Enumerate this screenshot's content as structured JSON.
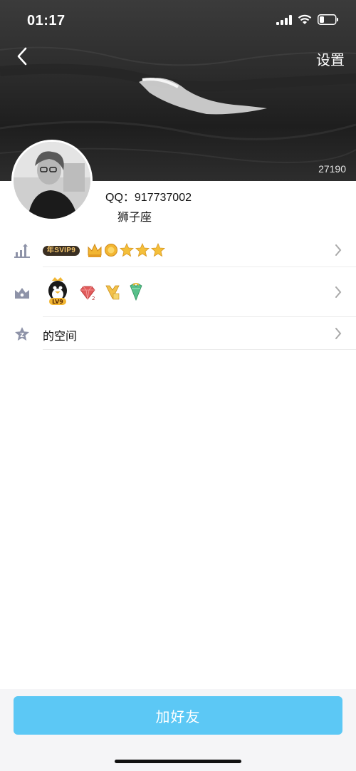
{
  "status_bar": {
    "time": "01:17",
    "icons": [
      "signal-icon",
      "wifi-icon",
      "battery-icon"
    ]
  },
  "header": {
    "back_icon": "chevron-left-icon",
    "settings_label": "设置",
    "like_count": "27190"
  },
  "profile": {
    "avatar_icon": "avatar",
    "qq_label": "QQ：",
    "qq_number": "917737002",
    "zodiac": "狮子座"
  },
  "rows": {
    "level": {
      "icon": "level-up-icon",
      "vip_badge": "年SVIP9",
      "level_icons": [
        "crown-icon",
        "sun-icon",
        "star-icon",
        "star-icon",
        "star-icon"
      ]
    },
    "badges": {
      "icon": "crown-outline-icon",
      "items": [
        "qq-penguin-lv9-icon",
        "diamond-icon",
        "yellow-diamond-icon",
        "green-diamond-icon"
      ]
    },
    "space": {
      "icon": "star-space-icon",
      "label": "的空间"
    }
  },
  "colors": {
    "accent": "#5cc8f5",
    "vip_text": "#f3c46b",
    "gold": "#f2b632"
  },
  "actions": {
    "add_friend": "加好友"
  }
}
